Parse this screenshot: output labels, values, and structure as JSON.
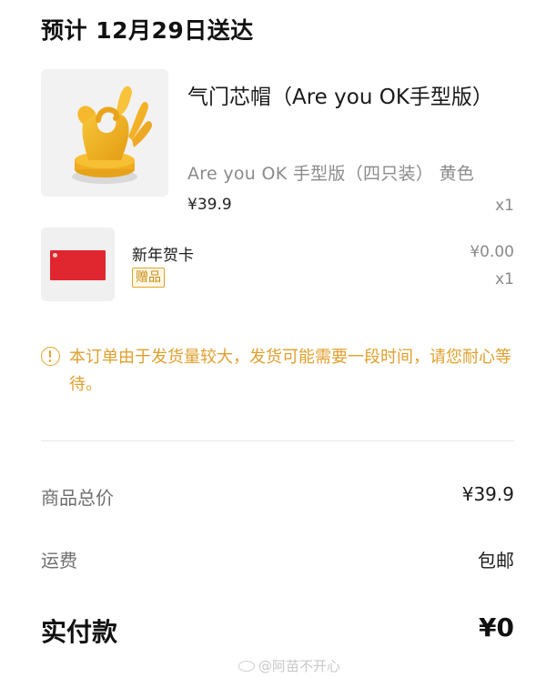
{
  "delivery": {
    "title": "预计 12月29日送达"
  },
  "product": {
    "name": "气门芯帽（Are you OK手型版）",
    "variant": "Are you OK 手型版（四只装） 黄色",
    "price": "¥39.9",
    "quantity": "x1",
    "image_icon": "ok-hand-figurine-icon",
    "image_color": "#f2b51f"
  },
  "gift": {
    "name": "新年贺卡",
    "badge": "赠品",
    "price": "¥0.00",
    "quantity": "x1",
    "image_icon": "red-greeting-card-icon",
    "image_color": "#e0262f"
  },
  "notice": {
    "icon": "info-circle-icon",
    "text": "本订单由于发货量较大，发货可能需要一段时间，请您耐心等待。",
    "color": "#e0a02e"
  },
  "summary": {
    "subtotal_label": "商品总价",
    "subtotal_value": "¥39.9",
    "shipping_label": "运费",
    "shipping_value": "包邮"
  },
  "total": {
    "label": "实付款",
    "value": "¥0"
  },
  "watermark": {
    "text": "@阿苗不开心",
    "icon": "weibo-logo-icon"
  }
}
